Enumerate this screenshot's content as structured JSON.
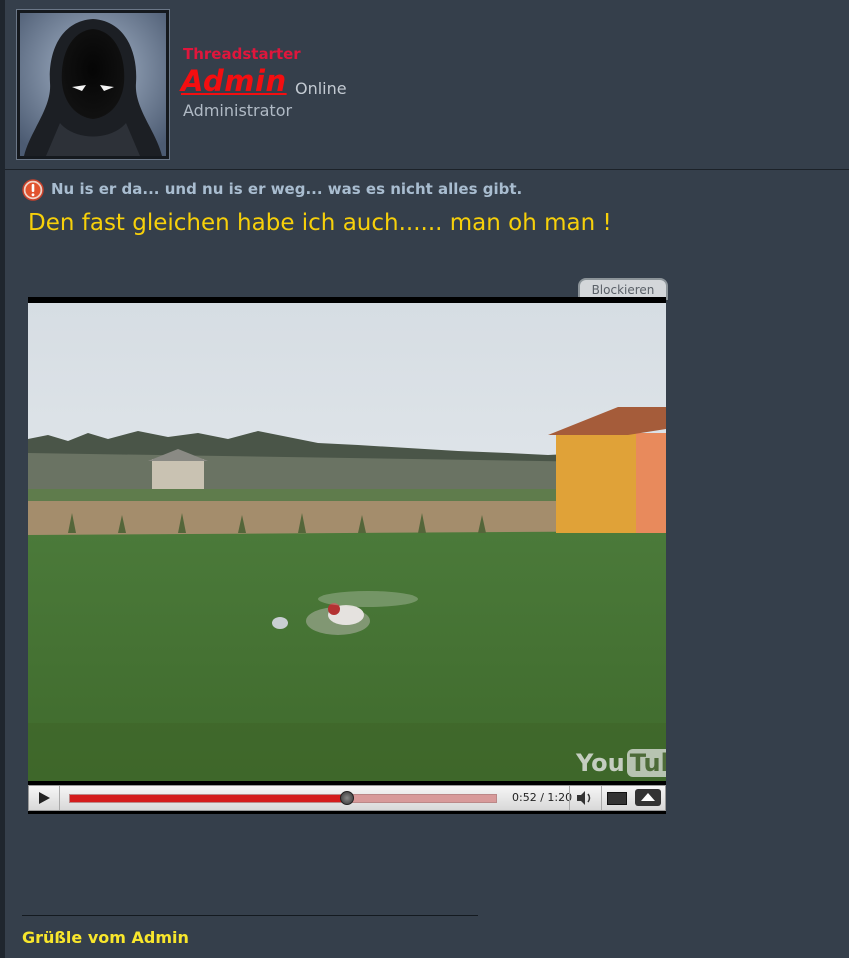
{
  "author": {
    "threadstarter_label": "Threadstarter",
    "username": "Admin",
    "status": "Online",
    "rank": "Administrator"
  },
  "post": {
    "title": "Nu is er da... und nu is er weg... was es nicht alles gibt.",
    "body": "Den fast gleichen habe ich auch...... man oh man !",
    "signature": "Grüßle vom Admin"
  },
  "video": {
    "block_label": "Blockieren",
    "logo_you": "You",
    "logo_tube": "Tube",
    "time": "0:52 / 1:20",
    "progress_fraction": 0.65,
    "progress_color": "#d41b1b"
  },
  "colors": {
    "background": "#353f4b",
    "username": "#f40e10",
    "body_text": "#f7d00a",
    "signature": "#f8e62c"
  }
}
